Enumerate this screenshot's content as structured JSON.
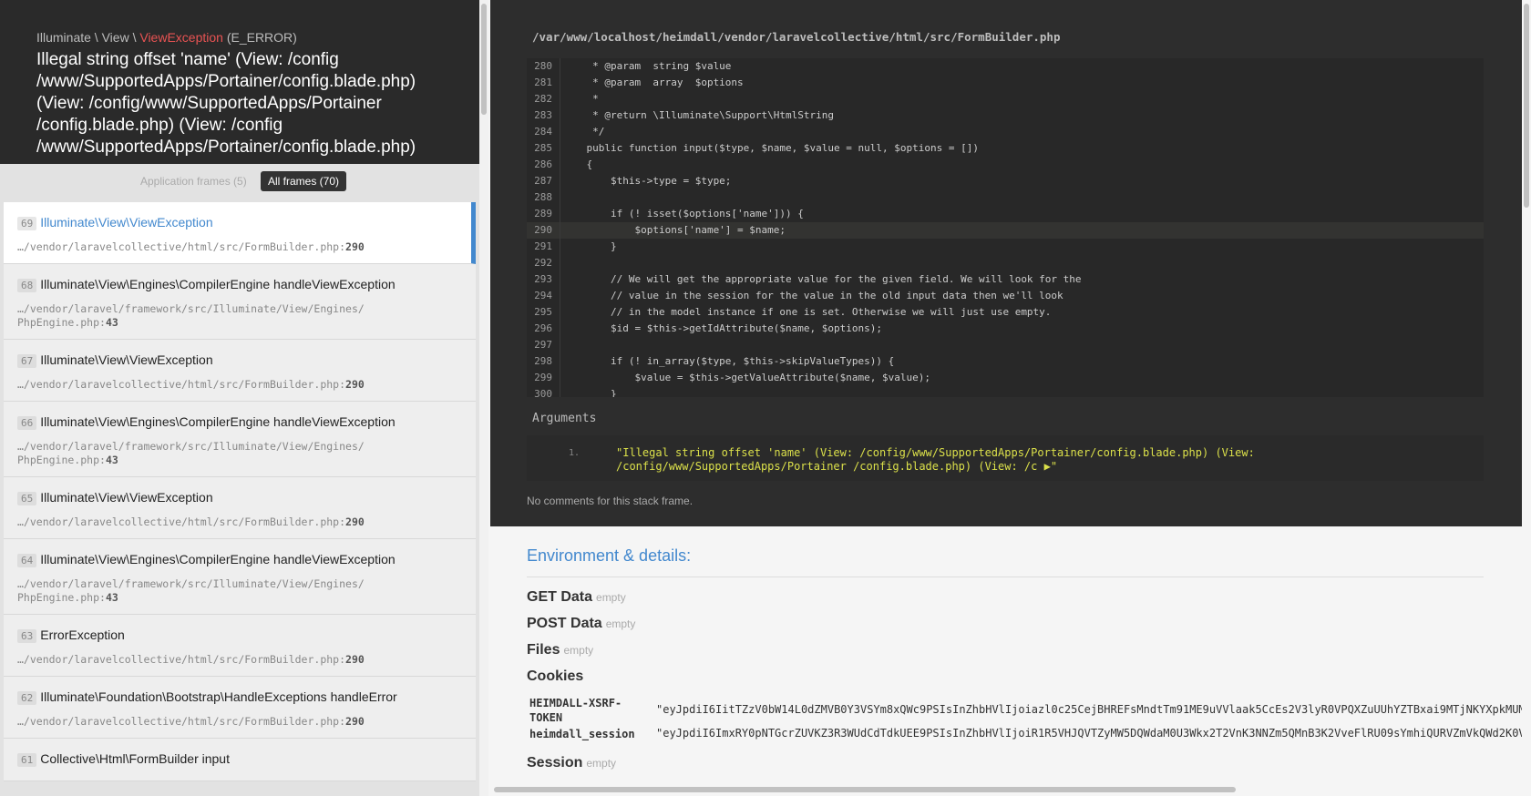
{
  "header": {
    "crumb1": "Illuminate",
    "sep1": " \\ ",
    "crumb2": "View",
    "sep2": " \\ ",
    "exception_class": "ViewException",
    "code": " (E_ERROR)",
    "message": "Illegal string offset 'name' (View: /config /www/SupportedApps/Portainer/config.blade.php) (View: /config/www/SupportedApps/Portainer /config.blade.php) (View: /config /www/SupportedApps/Portainer/config.blade.php)"
  },
  "filters": {
    "application": "Application frames (5)",
    "all": "All frames (70)"
  },
  "frames": [
    {
      "index": "69",
      "cls": "Illuminate\\View\\ViewException",
      "fn": "",
      "file": "…/vendor/laravelcollective/html/src/FormBuilder.php",
      "line": "290"
    },
    {
      "index": "68",
      "cls": "Illuminate\\View\\Engines\\CompilerEngine",
      "fn": "handleViewException",
      "file": "…/vendor/laravel/framework/src/Illuminate/View/Engines/ PhpEngine.php",
      "line": "43"
    },
    {
      "index": "67",
      "cls": "Illuminate\\View\\ViewException",
      "fn": "",
      "file": "…/vendor/laravelcollective/html/src/FormBuilder.php",
      "line": "290"
    },
    {
      "index": "66",
      "cls": "Illuminate\\View\\Engines\\CompilerEngine",
      "fn": "handleViewException",
      "file": "…/vendor/laravel/framework/src/Illuminate/View/Engines/ PhpEngine.php",
      "line": "43"
    },
    {
      "index": "65",
      "cls": "Illuminate\\View\\ViewException",
      "fn": "",
      "file": "…/vendor/laravelcollective/html/src/FormBuilder.php",
      "line": "290"
    },
    {
      "index": "64",
      "cls": "Illuminate\\View\\Engines\\CompilerEngine",
      "fn": "handleViewException",
      "file": "…/vendor/laravel/framework/src/Illuminate/View/Engines/ PhpEngine.php",
      "line": "43"
    },
    {
      "index": "63",
      "cls": "ErrorException",
      "fn": "",
      "file": "…/vendor/laravelcollective/html/src/FormBuilder.php",
      "line": "290"
    },
    {
      "index": "62",
      "cls": "Illuminate\\Foundation\\Bootstrap\\HandleExceptions",
      "fn": "handleError",
      "file": "…/vendor/laravelcollective/html/src/FormBuilder.php",
      "line": "290"
    },
    {
      "index": "61",
      "cls": "Collective\\Html\\FormBuilder",
      "fn": "input",
      "file": "",
      "line": ""
    }
  ],
  "code": {
    "path": "/var/www/localhost/heimdall/vendor/laravelcollective/html/src/FormBuilder.php",
    "highlight_line": "290",
    "lines": [
      {
        "n": "280",
        "t": "     * @param  string $value"
      },
      {
        "n": "281",
        "t": "     * @param  array  $options"
      },
      {
        "n": "282",
        "t": "     *"
      },
      {
        "n": "283",
        "t": "     * @return \\Illuminate\\Support\\HtmlString"
      },
      {
        "n": "284",
        "t": "     */"
      },
      {
        "n": "285",
        "t": "    public function input($type, $name, $value = null, $options = [])"
      },
      {
        "n": "286",
        "t": "    {"
      },
      {
        "n": "287",
        "t": "        $this->type = $type;"
      },
      {
        "n": "288",
        "t": ""
      },
      {
        "n": "289",
        "t": "        if (! isset($options['name'])) {"
      },
      {
        "n": "290",
        "t": "            $options['name'] = $name;"
      },
      {
        "n": "291",
        "t": "        }"
      },
      {
        "n": "292",
        "t": ""
      },
      {
        "n": "293",
        "t": "        // We will get the appropriate value for the given field. We will look for the"
      },
      {
        "n": "294",
        "t": "        // value in the session for the value in the old input data then we'll look"
      },
      {
        "n": "295",
        "t": "        // in the model instance if one is set. Otherwise we will just use empty."
      },
      {
        "n": "296",
        "t": "        $id = $this->getIdAttribute($name, $options);"
      },
      {
        "n": "297",
        "t": ""
      },
      {
        "n": "298",
        "t": "        if (! in_array($type, $this->skipValueTypes)) {"
      },
      {
        "n": "299",
        "t": "            $value = $this->getValueAttribute($name, $value);"
      },
      {
        "n": "300",
        "t": "        }"
      }
    ]
  },
  "arguments": {
    "label": "Arguments",
    "number": "1.",
    "value": "\"Illegal string offset 'name' (View: /config/www/SupportedApps/Portainer/config.blade.php) (View: /config/www/SupportedApps/Portainer /config.blade.php) (View: /c ▶\""
  },
  "no_comments": "No comments for this stack frame.",
  "details": {
    "title": "Environment & details:",
    "get": "GET Data",
    "post": "POST Data",
    "files": "Files",
    "cookies": "Cookies",
    "session": "Session",
    "empty": "empty",
    "cookie_rows": [
      {
        "k": "HEIMDALL-XSRF-TOKEN",
        "v": "\"eyJpdiI6IitTZzV0bW14L0dZMVB0Y3VSYm8xQWc9PSIsInZhbHVlIjoiazl0c25CejBHREFsMndtTm91ME9uVVlaak5CcEs2V3lyR0VPQXZuUUhYZTBxai9MTjNKYXpkMUM"
      },
      {
        "k": "heimdall_session",
        "v": "\"eyJpdiI6ImxRY0pNTGcrZUVKZ3R3WUdCdTdkUEE9PSIsInZhbHVlIjoiR1R5VHJQVTZyMW5DQWdaM0U3Wkx2T2VnK3NNZm5QMnB3K2VveFlRU09sYmhiQURVZmVkQWd2K0V"
      }
    ]
  }
}
